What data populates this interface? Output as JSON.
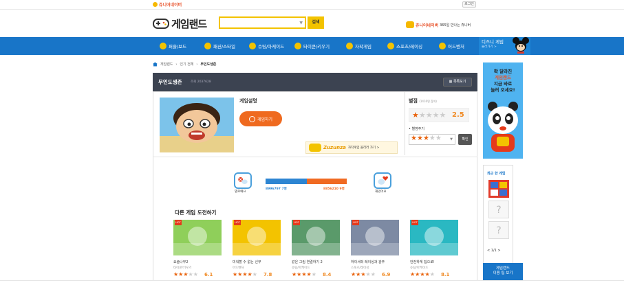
{
  "brand": {
    "junior_logo": "쥬니어네이버",
    "login": "로그인",
    "game_logo": "게임랜드"
  },
  "search": {
    "placeholder": "",
    "button": "검색"
  },
  "promo": {
    "brand": "쥬니어네이버",
    "text": "365일 만나는 쥬니버"
  },
  "nav": {
    "items": [
      "퍼즐/보드",
      "패션/스타일",
      "슈팅/아케이드",
      "타이쿤/키우기",
      "자작게임",
      "스포츠/레이싱",
      "어드벤처"
    ],
    "disney_title": "디즈니 게임",
    "disney_sub": "놀러가기 >"
  },
  "breadcrumb": [
    "게임랜드",
    "인기 전체",
    "무인도생존"
  ],
  "game": {
    "title": "무인도생존",
    "id_label": "조회 2037628",
    "list_button": "목록보기",
    "desc_heading": "게임설명",
    "play_button": "게임하기",
    "zuzunza_brand": "Zuzunza",
    "zuzunza_text": "자작게임 올리러 가기 >"
  },
  "rating": {
    "heading": "별점",
    "participants": "(1416명 참여)",
    "score": "2.5",
    "score_value": 1.25,
    "give_label": "별점주기",
    "selected_stars": 3,
    "confirm": "확인"
  },
  "vote": {
    "bad_label": "별로예요",
    "bad_count": "8996797 7명",
    "good_label": "재밌어요",
    "good_count": "8856210 9명",
    "bad_ratio": 0.51
  },
  "other": {
    "heading": "다른 게임 도전하기",
    "hot_badge": "HOT",
    "cards": [
      {
        "title": "요술나무2",
        "category": "타이쿤/키우기",
        "score": "6.1",
        "stars": 3,
        "color": "#8fcf5a"
      },
      {
        "title": "미워할 수 없는 신부",
        "category": "어드벤처",
        "score": "7.8",
        "stars": 4,
        "color": "#f3c300"
      },
      {
        "title": "같은 그림 연결하기 2",
        "category": "슈팅/아케이드",
        "score": "8.4",
        "stars": 4,
        "color": "#5a9a6a"
      },
      {
        "title": "하이서퍼 레이싱과 광주",
        "category": "스포츠/레이싱",
        "score": "6.9",
        "stars": 3,
        "color": "#7d8aa3"
      },
      {
        "title": "안전하게 집으로!",
        "category": "슈팅/아케이드",
        "score": "8.1",
        "stars": 4,
        "color": "#2ab8c2"
      }
    ]
  },
  "ad": {
    "lines": [
      "확 달라진",
      "게임랜드",
      "지금 바로",
      "놀러 오세요!"
    ]
  },
  "recent": {
    "heading": "최근 한 게임",
    "placeholder_mark": "?",
    "pager": "< 1/1 >"
  },
  "bottom_ad": {
    "line1": "게임랜드",
    "line2": "이용 팁 보기"
  }
}
